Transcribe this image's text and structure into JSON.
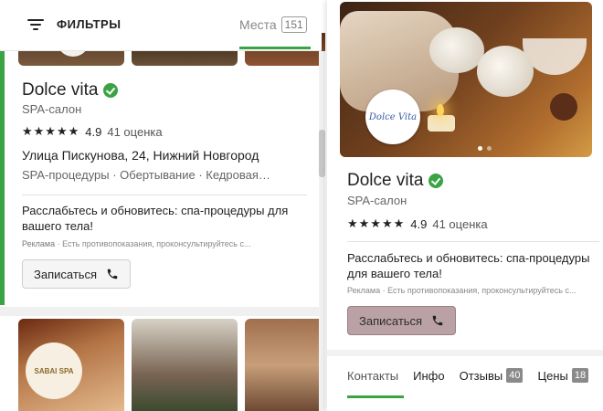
{
  "left_panel": {
    "filters_label": "ФИЛЬТРЫ",
    "places_tab": {
      "label": "Места",
      "count": "151"
    },
    "card": {
      "name": "Dolce vita",
      "category": "SPA-салон",
      "stars": "★★★★★",
      "rating": "4.9",
      "reviews": "41 оценка",
      "address": "Улица Пискунова, 24, Нижний Новгород",
      "services": "SPA-процедуры · Обертывание · Кедровая…",
      "ad_text": "Расслабьтесь и обновитесь: спа-процедуры для вашего тела!",
      "ad_label": "Реклама",
      "disclaimer": "Есть противопоказания, проконсультируйтесь с...",
      "book_label": "Записаться"
    },
    "next_card": {
      "logo_text": "SABAI SPA"
    }
  },
  "right_panel": {
    "logo_text": "Dolce Vita",
    "name": "Dolce vita",
    "category": "SPA-салон",
    "stars": "★★★★★",
    "rating": "4.9",
    "reviews": "41 оценка",
    "ad_text": "Расслабьтесь и обновитесь: спа-процедуры для вашего тела!",
    "ad_label": "Реклама",
    "disclaimer": "Есть противопоказания, проконсультируйтесь с...",
    "book_label": "Записаться",
    "tabs": [
      {
        "label": "Контакты",
        "badge": ""
      },
      {
        "label": "Инфо",
        "badge": ""
      },
      {
        "label": "Отзывы",
        "badge": "40"
      },
      {
        "label": "Цены",
        "badge": "18"
      }
    ]
  },
  "colors": {
    "accent": "#3aa344",
    "book_button_active": "#b9a1a6",
    "badge": "#8a8a8a"
  }
}
